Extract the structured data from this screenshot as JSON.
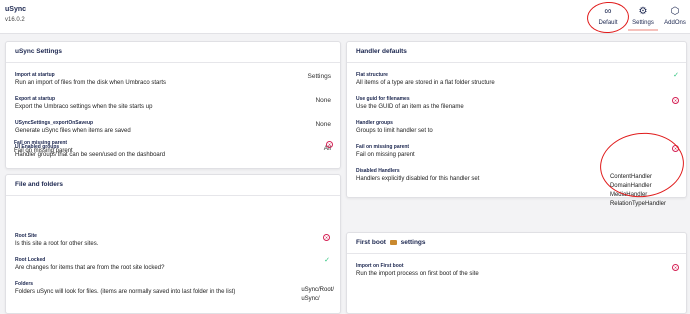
{
  "app": {
    "name": "uSync",
    "version": "v16.0.2"
  },
  "header": {
    "buttons": [
      {
        "label": "Default",
        "icon": "infinity-icon"
      },
      {
        "label": "Settings",
        "icon": "gear-icon"
      },
      {
        "label": "AddOns",
        "icon": "cube-icon"
      }
    ]
  },
  "usync_settings": {
    "title": "uSync Settings",
    "rows": [
      {
        "name": "Import at startup",
        "desc": "Run an import of files from the disk when Umbraco starts",
        "value": "Settings"
      },
      {
        "name": "Export at startup",
        "desc": "Export the Umbraco settings when the site starts up",
        "value": "None"
      },
      {
        "name": "USyncSettings_exportOnSaveup",
        "desc": "Generate uSync files when items are saved",
        "value": "None"
      },
      {
        "name": "UI Enabled groups",
        "desc": "Handler groups that can be seen/used on the dashboard",
        "value": "All"
      },
      {
        "name": "Fail on missing parent",
        "desc": "Fail on missing parent",
        "value": ""
      }
    ]
  },
  "files_folders": {
    "title": "File and folders",
    "rows": [
      {
        "name": "Root Site",
        "desc": "Is this site a root for other sites."
      },
      {
        "name": "Root Locked",
        "desc": "Are changes for items that are from the root site locked?"
      },
      {
        "name": "Folders",
        "desc": "Folders uSync will look for files. (items are normally saved into last folder in the list)",
        "values": [
          "uSync/Root/",
          "uSync/"
        ]
      }
    ]
  },
  "handler_defaults": {
    "title": "Handler defaults",
    "rows": [
      {
        "name": "Flat structure",
        "desc": "All items of a type are stored in a flat folder structure"
      },
      {
        "name": "Use guid for filenames",
        "desc": "Use the GUID of an item as the filename"
      },
      {
        "name": "Handler groups",
        "desc": "Groups to limit handler set to"
      },
      {
        "name": "Fail on missing parent",
        "desc": "Fail on missing parent"
      },
      {
        "name": "Disabled Handlers",
        "desc": "Handlers explicitly disabled for this handler set",
        "values": [
          "ContentHandler",
          "DomainHandler",
          "MediaHandler",
          "RelationTypeHandler"
        ]
      }
    ]
  },
  "first_boot": {
    "title": "First boot",
    "title_suffix": "settings",
    "rows": [
      {
        "name": "Import on First boot",
        "desc": "Run the import process on first boot of the site"
      }
    ]
  },
  "colors": {
    "true": "#2bc37c",
    "false": "#d42054",
    "annotation": "#e01b1b",
    "text": "#1b264f"
  }
}
